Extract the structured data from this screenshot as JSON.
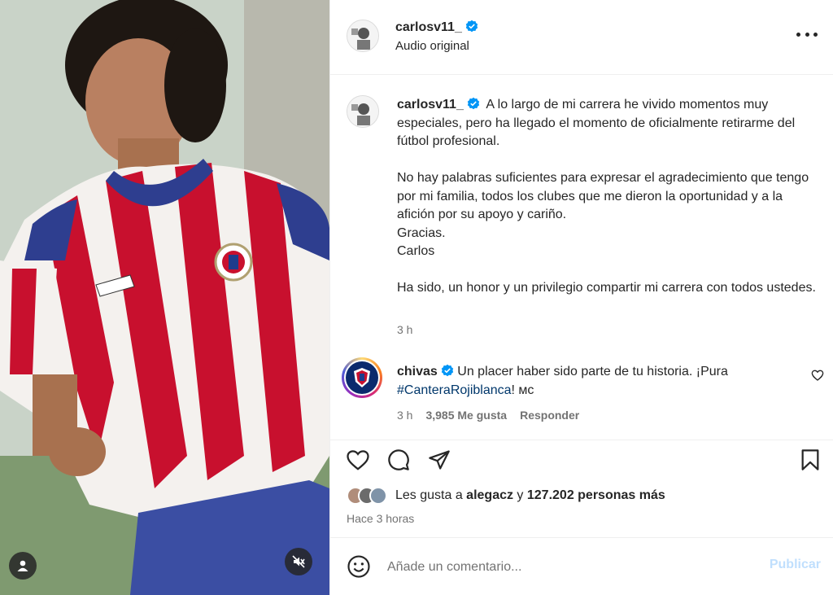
{
  "header": {
    "username": "carlosv11_",
    "audio": "Audio original"
  },
  "caption": {
    "username": "carlosv11_",
    "paragraph1": "A lo largo de mi carrera he vivido momentos muy especiales, pero ha llegado el momento de oficialmente retirarme del fútbol profesional.",
    "paragraph2": "No hay palabras suficientes para expresar el agradecimiento que tengo por mi familia, todos los clubes que me dieron la oportunidad y a la afición por su apoyo y cariño.",
    "line3": "Gracias.",
    "line4": "Carlos",
    "paragraph5": "Ha sido, un honor y un privilegio compartir mi carrera con todos ustedes.",
    "time": "3 h"
  },
  "comment": {
    "username": "chivas",
    "text_before": "Un placer haber sido parte de tu historia. ¡Pura ",
    "hashtag": "#CanteraRojiblanca",
    "text_after": "! мс",
    "time": "3 h",
    "likes": "3,985 Me gusta",
    "reply": "Responder"
  },
  "likes": {
    "prefix": "Les gusta a ",
    "user": "alegacz",
    "middle": " y ",
    "others": "127.202 personas más"
  },
  "posted_ago": "Hace 3 horas",
  "add_comment": {
    "placeholder": "Añade un comentario...",
    "publish": "Publicar"
  },
  "colors": {
    "verified": "#0095f6",
    "hashtag": "#00376b",
    "muted_text": "#737373",
    "publish_disabled": "#c0dffd"
  }
}
